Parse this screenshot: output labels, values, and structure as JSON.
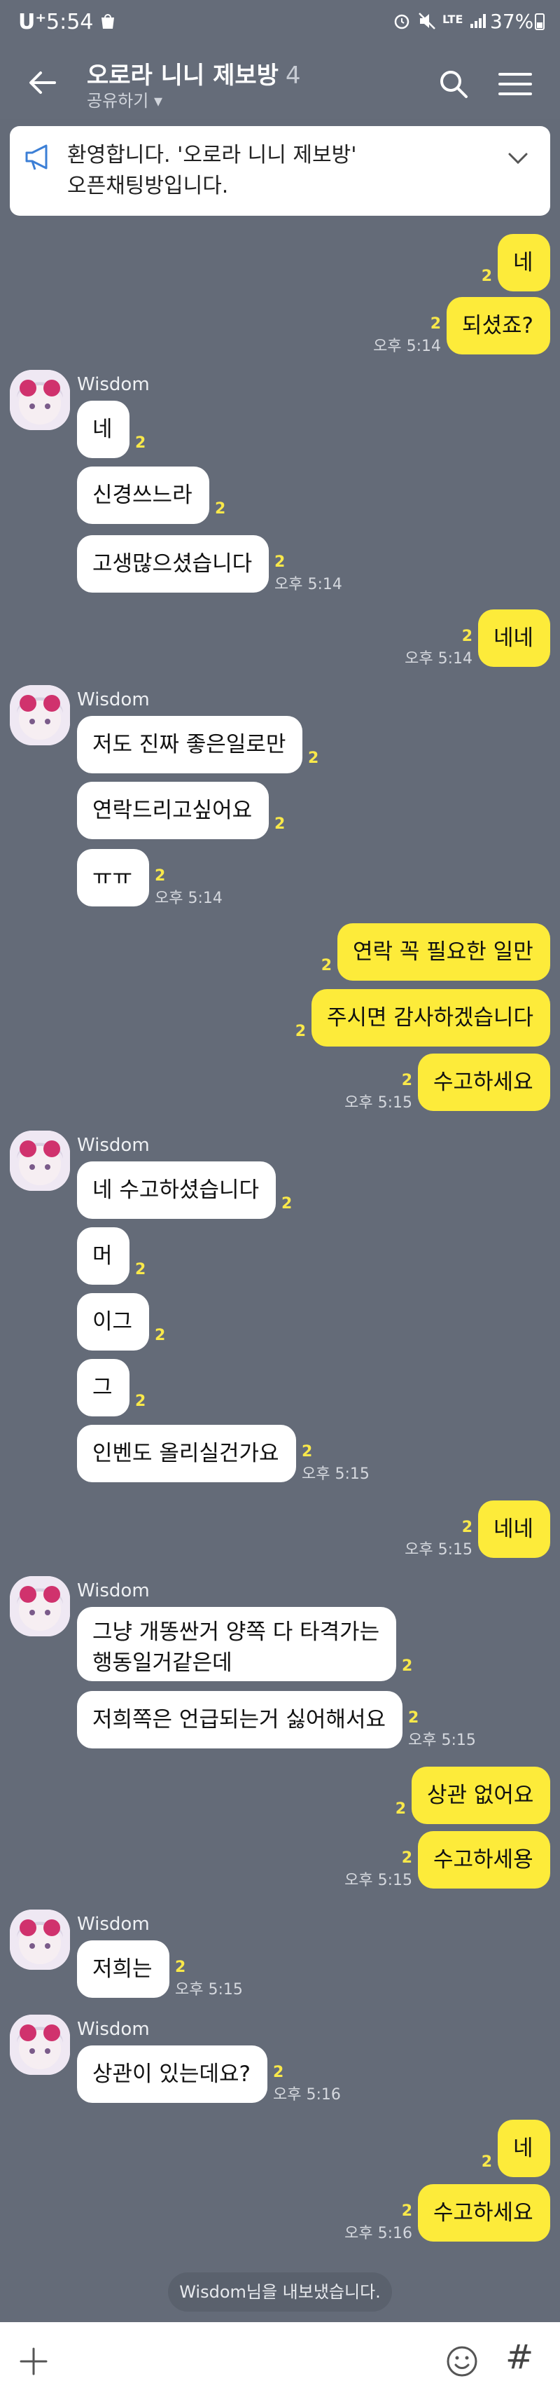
{
  "status_bar": {
    "carrier": "U⁺",
    "time": "5:54",
    "network": "LTE",
    "battery": "37%"
  },
  "header": {
    "title": "오로라 니니 제보방",
    "member_count": "4",
    "share_label": "공유하기 ▾"
  },
  "notice": {
    "line1": "환영합니다. '오로라 니니 제보방'",
    "line2": "오픈채팅방입니다."
  },
  "sender_name": "Wisdom",
  "messages": [
    {
      "text": "네",
      "unread": "2"
    },
    {
      "text": "되셨죠?",
      "unread": "2",
      "time": "오후 5:14"
    },
    {
      "text": "네",
      "unread": "2"
    },
    {
      "text": "신경쓰느라",
      "unread": "2"
    },
    {
      "text": "고생많으셨습니다",
      "unread": "2",
      "time": "오후 5:14"
    },
    {
      "text": "네네",
      "unread": "2",
      "time": "오후 5:14"
    },
    {
      "text": "저도 진짜 좋은일로만",
      "unread": "2"
    },
    {
      "text": "연락드리고싶어요",
      "unread": "2"
    },
    {
      "text": "ㅠㅠ",
      "unread": "2",
      "time": "오후 5:14"
    },
    {
      "text": "연락 꼭 필요한 일만",
      "unread": "2"
    },
    {
      "text": "주시면 감사하겠습니다",
      "unread": "2"
    },
    {
      "text": "수고하세요",
      "unread": "2",
      "time": "오후 5:15"
    },
    {
      "text": "네 수고하셨습니다",
      "unread": "2"
    },
    {
      "text": "머",
      "unread": "2"
    },
    {
      "text": "이그",
      "unread": "2"
    },
    {
      "text": "그",
      "unread": "2"
    },
    {
      "text": "인벤도 올리실건가요",
      "unread": "2",
      "time": "오후 5:15"
    },
    {
      "text": "네네",
      "unread": "2",
      "time": "오후 5:15"
    },
    {
      "text": "그냥 개똥싼거 양쪽 다 타격가는\n행동일거같은데",
      "unread": "2"
    },
    {
      "text": "저희쪽은 언급되는거 싫어해서요",
      "unread": "2",
      "time": "오후 5:15"
    },
    {
      "text": "상관 없어요",
      "unread": "2"
    },
    {
      "text": "수고하세용",
      "unread": "2",
      "time": "오후 5:15"
    },
    {
      "text": "저희는",
      "unread": "2",
      "time": "오후 5:15"
    },
    {
      "text": "상관이 있는데요?",
      "unread": "2",
      "time": "오후 5:16"
    },
    {
      "text": "네",
      "unread": "2"
    },
    {
      "text": "수고하세요",
      "unread": "2",
      "time": "오후 5:16"
    }
  ],
  "system_message": "Wisdom님을 내보냈습니다.",
  "input_bar": {
    "hash_label": "#"
  },
  "colors": {
    "background": "#646b78",
    "my_bubble": "#fdeb3a",
    "other_bubble": "#ffffff",
    "unread": "#f9e84a"
  }
}
